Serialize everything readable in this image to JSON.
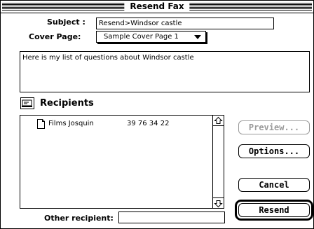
{
  "window": {
    "title": "Resend Fax"
  },
  "subject": {
    "label": "Subject :",
    "value": "Resend>Windsor castle"
  },
  "cover_page": {
    "label": "Cover Page:",
    "selected": "Sample Cover Page 1"
  },
  "message": {
    "text": "Here is my list of questions about Windsor castle"
  },
  "recipients": {
    "heading": "Recipients",
    "icon": "rolodex-icon",
    "items": [
      {
        "name": "Films Josquin",
        "number": "39 76 34 22",
        "icon": "document-icon"
      }
    ]
  },
  "buttons": {
    "preview": "Preview...",
    "options": "Options...",
    "cancel": "Cancel",
    "resend": "Resend"
  },
  "other_recipient": {
    "label": "Other recipient:",
    "value": ""
  }
}
